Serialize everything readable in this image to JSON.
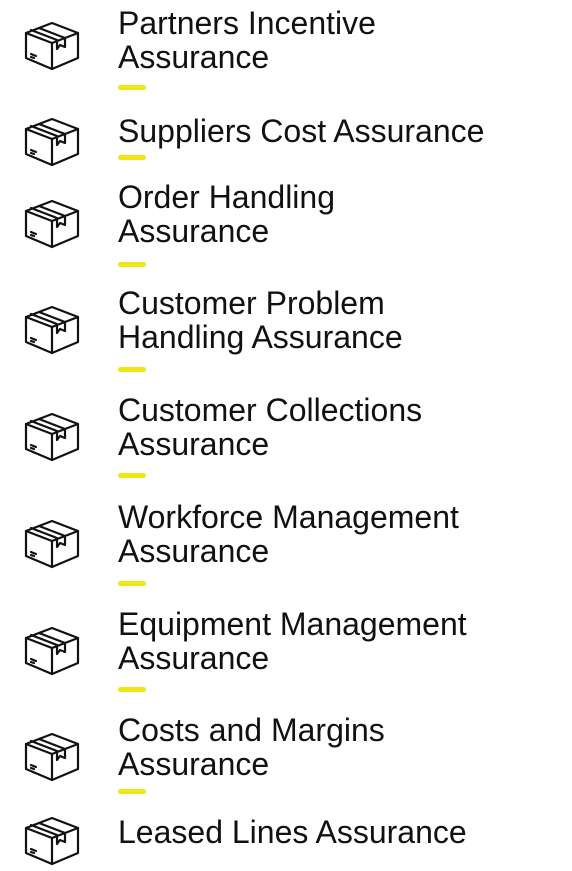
{
  "accent_color": "#f2e516",
  "items": [
    {
      "icon": "package-box-icon",
      "label": "Partners Incentive Assurance"
    },
    {
      "icon": "package-box-icon",
      "label": "Suppliers Cost Assurance"
    },
    {
      "icon": "package-box-icon",
      "label": "Order Handling Assurance"
    },
    {
      "icon": "package-box-icon",
      "label": "Customer Problem Handling Assurance"
    },
    {
      "icon": "package-box-icon",
      "label": "Customer Collections Assurance"
    },
    {
      "icon": "package-box-icon",
      "label": "Workforce Management Assurance"
    },
    {
      "icon": "package-box-icon",
      "label": "Equipment Management Assurance"
    },
    {
      "icon": "package-box-icon",
      "label": "Costs and Margins Assurance"
    },
    {
      "icon": "package-box-icon",
      "label": "Leased Lines Assurance"
    }
  ]
}
